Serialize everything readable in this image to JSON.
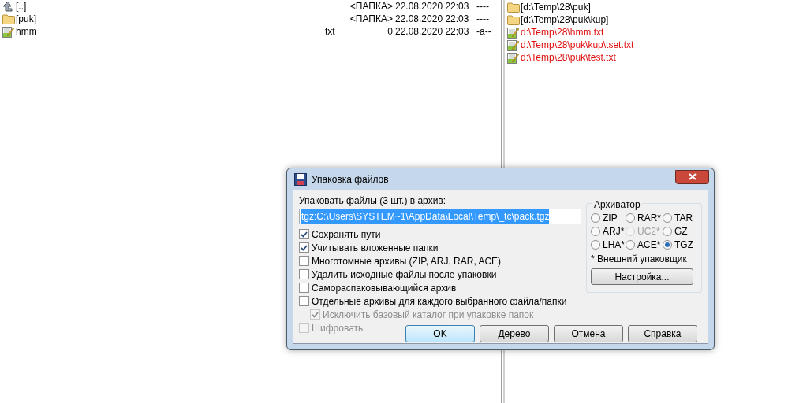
{
  "left_panel": {
    "rows": [
      {
        "kind": "up",
        "name": "[..]",
        "ext": "",
        "size": "<ПАПКА>",
        "date": "22.08.2020 22:03",
        "attributes": "----"
      },
      {
        "kind": "folder",
        "name": "[puk]",
        "ext": "",
        "size": "<ПАПКА>",
        "date": "22.08.2020 22:03",
        "attributes": "----"
      },
      {
        "kind": "file",
        "name": "hmm",
        "ext": "txt",
        "size": "0",
        "date": "22.08.2020 22:03",
        "attributes": "-a--"
      }
    ]
  },
  "right_panel": {
    "rows": [
      {
        "kind": "folder",
        "name": "[d:\\Temp\\28\\puk]"
      },
      {
        "kind": "folder",
        "name": "[d:\\Temp\\28\\puk\\kup]"
      },
      {
        "kind": "file",
        "name": "d:\\Temp\\28\\hmm.txt"
      },
      {
        "kind": "file",
        "name": "d:\\Temp\\28\\puk\\kup\\tset.txt"
      },
      {
        "kind": "file",
        "name": "d:\\Temp\\28\\puk\\test.txt"
      }
    ]
  },
  "dialog": {
    "title": "Упаковка файлов",
    "archive_label": "Упаковать файлы (3 шт.) в архив:",
    "archive_path": {
      "value": "tgz:C:\\Users\\SYSTEM~1\\AppData\\Local\\Temp\\_tc\\pack.tgz",
      "text_selected": true
    },
    "options": [
      {
        "label": "Сохранять пути",
        "checked": true,
        "disabled": false
      },
      {
        "label": "Учитывать вложенные папки",
        "checked": true,
        "disabled": false
      },
      {
        "label": "Многотомные архивы (ZIP, ARJ, RAR, ACE)",
        "checked": false,
        "disabled": false
      },
      {
        "label": "Удалить исходные файлы после упаковки",
        "checked": false,
        "disabled": false
      },
      {
        "label": "Самораспаковывающийся архив",
        "checked": false,
        "disabled": false
      },
      {
        "label": "Отдельные архивы для каждого выбранного файла/папки",
        "checked": false,
        "disabled": false,
        "children": [
          {
            "label": "Исключить базовый каталог при упаковке папок",
            "checked": true,
            "disabled": true
          }
        ]
      },
      {
        "label": "Шифровать",
        "checked": false,
        "disabled": true
      }
    ],
    "archiver": {
      "title": "Архиватор",
      "options": [
        {
          "label": "ZIP",
          "selected": false,
          "disabled": false
        },
        {
          "label": "RAR*",
          "selected": false,
          "disabled": false
        },
        {
          "label": "TAR",
          "selected": false,
          "disabled": false
        },
        {
          "label": "ARJ*",
          "selected": false,
          "disabled": false
        },
        {
          "label": "UC2*",
          "selected": false,
          "disabled": true
        },
        {
          "label": "GZ",
          "selected": false,
          "disabled": false
        },
        {
          "label": "LHA*",
          "selected": false,
          "disabled": false
        },
        {
          "label": "ACE*",
          "selected": false,
          "disabled": false
        },
        {
          "label": "TGZ",
          "selected": true,
          "disabled": false
        }
      ],
      "note": "* Внешний упаковщик",
      "settings_button": "Настройка..."
    },
    "buttons": [
      {
        "label": "OK",
        "default": true
      },
      {
        "label": "Дерево",
        "default": false
      },
      {
        "label": "Отмена",
        "default": false
      },
      {
        "label": "Справка",
        "default": false
      }
    ]
  }
}
